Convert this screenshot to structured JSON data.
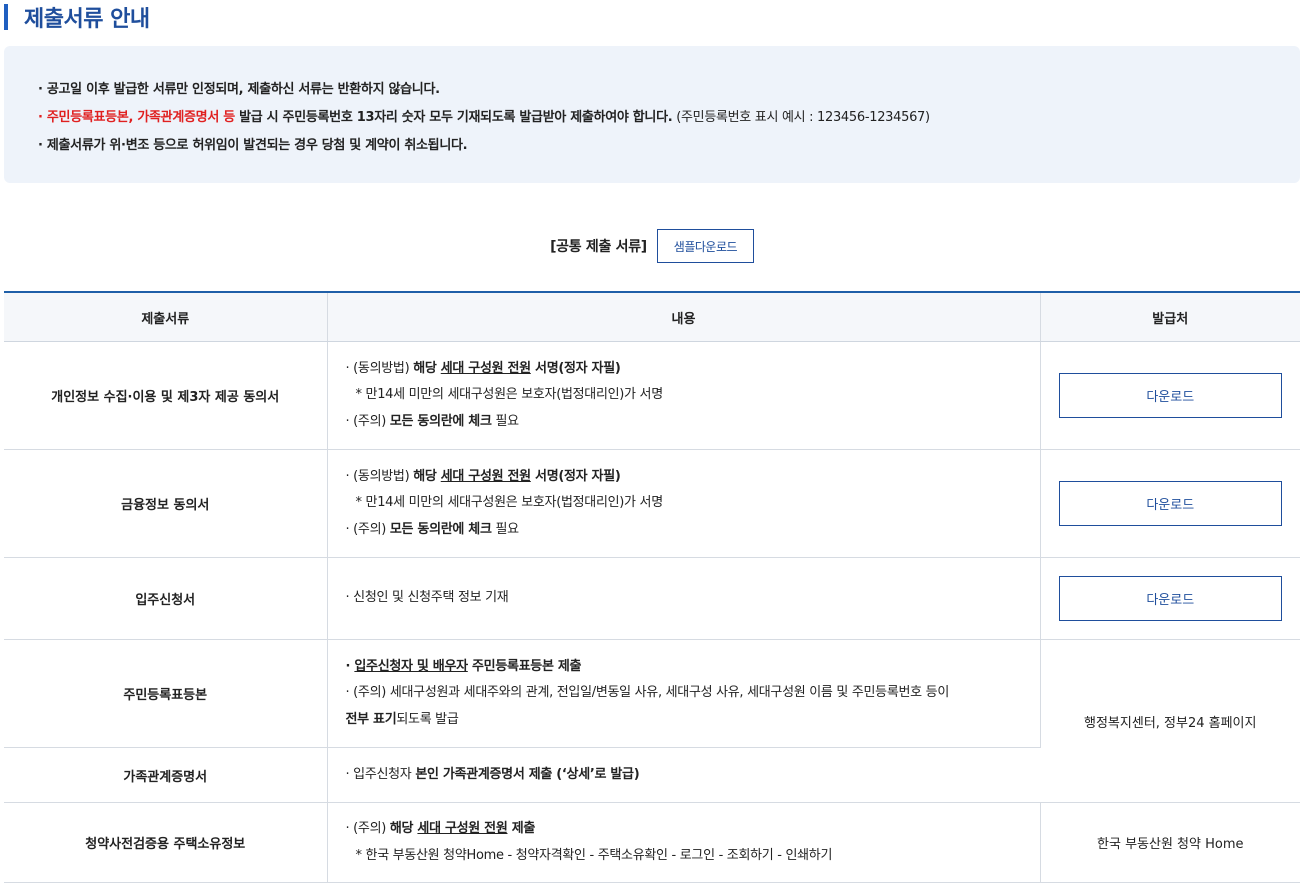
{
  "header": {
    "title": "제출서류 안내"
  },
  "notice": {
    "line1": "· 공고일 이후 발급한 서류만 인정되며, 제출하신 서류는 반환하지 않습니다.",
    "line2_prefix": "· ",
    "line2_red": "주민등록표등본, 가족관계증명서 등",
    "line2_bold": " 발급 시 주민등록번호 13자리 숫자 모두 기재되도록 발급받아 제출하여야 합니다.",
    "line2_normal": " (주민등록번호 표시 예시 : 123456-1234567)",
    "line3": "· 제출서류가 위·변조 등으로 허위임이 발견되는 경우 당첨 및 계약이 취소됩니다."
  },
  "common": {
    "label": "[공통 제출 서류]",
    "sample_button": "샘플다운로드"
  },
  "table": {
    "headers": {
      "doc": "제출서류",
      "content": "내용",
      "issuer": "발급처"
    },
    "download_label": "다운로드",
    "rows": {
      "r1": {
        "doc": "개인정보 수집·이용 및 제3자 제공 동의서",
        "l1_a": "· (동의방법) ",
        "l1_b": "해당 ",
        "l1_c": "세대 구성원 전원",
        "l1_d": " 서명(정자 자필)",
        "l2": "* 만14세 미만의 세대구성원은 보호자(법정대리인)가 서명",
        "l3_a": "· (주의) ",
        "l3_b": "모든 동의란에 체크",
        "l3_c": " 필요"
      },
      "r2": {
        "doc": "금융정보 동의서",
        "l1_a": "· (동의방법) ",
        "l1_b": "해당 ",
        "l1_c": "세대 구성원 전원",
        "l1_d": " 서명(정자 자필)",
        "l2": "* 만14세 미만의 세대구성원은 보호자(법정대리인)가 서명",
        "l3_a": "· (주의) ",
        "l3_b": "모든 동의란에 체크",
        "l3_c": " 필요"
      },
      "r3": {
        "doc": "입주신청서",
        "l1": "· 신청인 및 신청주택 정보 기재"
      },
      "r4": {
        "doc": "주민등록표등본",
        "l1_a": "· ",
        "l1_b": "입주신청자 및 배우자",
        "l1_c": " 주민등록표등본 제출",
        "l2": "· (주의) 세대구성원과 세대주와의 관계, 전입일/변동일 사유, 세대구성 사유, 세대구성원 이름 및 주민등록번호 등이",
        "l3_a": "전부 표기",
        "l3_b": "되도록 발급",
        "issuer": "행정복지센터, 정부24 홈페이지"
      },
      "r5": {
        "doc": "가족관계증명서",
        "l1_a": "· 입주신청자 ",
        "l1_b": "본인 가족관계증명서 제출 (‘상세’로 발급)"
      },
      "r6": {
        "doc": "청약사전검증용 주택소유정보",
        "l1_a": "· (주의) ",
        "l1_b": "해당 ",
        "l1_c": "세대 구성원 전원",
        "l1_d": " 제출",
        "l2": "* 한국 부동산원 청약Home - 청약자격확인 - 주택소유확인 - 로그인 - 조회하기 - 인쇄하기",
        "issuer": "한국 부동산원 청약 Home"
      }
    }
  },
  "colors": {
    "accent": "#1f4e9c",
    "notice_bg": "#eef3fa",
    "warning_red": "#e02020"
  }
}
